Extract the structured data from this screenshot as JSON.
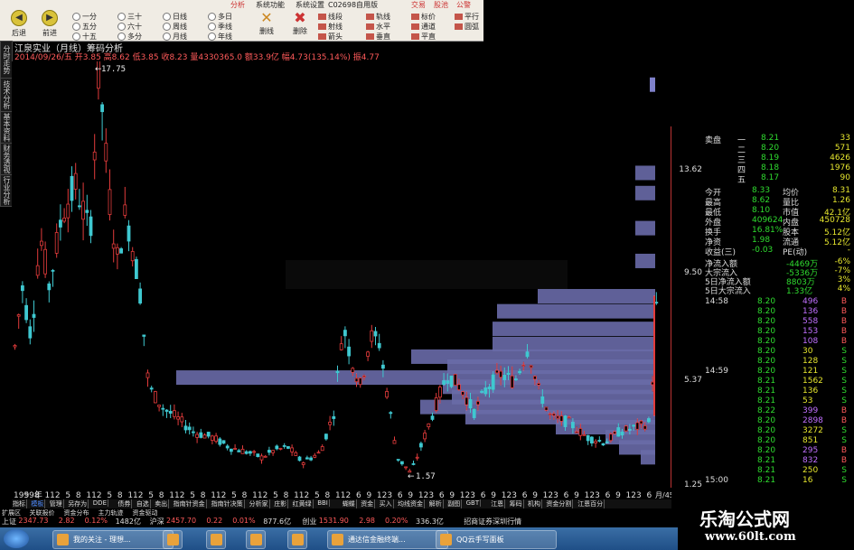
{
  "menu": {
    "items": [
      "分析",
      "系统功能",
      "系统设置",
      "C02698自用版",
      "交易",
      "股池",
      "公警"
    ]
  },
  "toolbar": {
    "back": "后退",
    "forward": "前进",
    "periods": [
      "一分",
      "五分",
      "十五",
      "三十",
      "六十",
      "多分",
      "日线",
      "周线",
      "月线",
      "多日",
      "季线",
      "年线"
    ],
    "delete_draw": "删线",
    "delete_all": "删除",
    "draw_tools": [
      "线段",
      "射线",
      "箭头",
      "轨线",
      "水平",
      "垂直",
      "标价",
      "通道",
      "平直",
      "平行",
      "圆弧"
    ]
  },
  "header": {
    "title": "江泉实业（月线）筹码分析",
    "quote": "2014/09/26/五 开3.85 高8.62 低3.85 收8.23 量4330365.0 额33.9亿 幅4.73(135.14%) 振4.77"
  },
  "left_tabs": [
    "分时走势",
    "技术分析",
    "基本资料",
    "财务透视",
    "行业分析"
  ],
  "chart_data": {
    "type": "candlestick",
    "price_axis_ticks": [
      "13.62",
      "9.50",
      "5.37",
      "1.25"
    ],
    "annotations": {
      "high": "17.75",
      "low": "1.57"
    },
    "x_tick_labels": [
      "1999年",
      "5",
      "8",
      "11",
      "2",
      "5",
      "8",
      "11",
      "2",
      "5",
      "8",
      "11",
      "2",
      "5",
      "8",
      "11",
      "2",
      "5",
      "8",
      "11",
      "2",
      "5",
      "8",
      "11",
      "2",
      "5",
      "8",
      "11",
      "2",
      "5",
      "8",
      "11",
      "2",
      "6",
      "9",
      "12",
      "3",
      "6",
      "9",
      "12",
      "3",
      "6",
      "9",
      "12",
      "3",
      "6",
      "9",
      "12",
      "3",
      "6",
      "9",
      "12",
      "3",
      "6",
      "9",
      "12",
      "3",
      "6",
      "9",
      "12",
      "3",
      "6"
    ],
    "x_axis_edge": "月/45",
    "colors": {
      "up": "#e23b3b",
      "down": "#3fc8d0",
      "chip_bar": "#8d8fe0"
    }
  },
  "quote_panel": {
    "sell": [
      {
        "label": "卖盘",
        "level": "一",
        "price": "8.21",
        "vol": "33"
      }
    ],
    "buy": [
      {
        "level": "二",
        "price": "8.20",
        "vol": "571"
      },
      {
        "level": "三",
        "price": "8.19",
        "vol": "4626"
      },
      {
        "level": "四",
        "price": "8.18",
        "vol": "1976"
      },
      {
        "level": "五",
        "price": "8.17",
        "vol": "90"
      }
    ],
    "stats": [
      {
        "k1": "今开",
        "v1": "8.33",
        "k2": "均价",
        "v2": "8.31"
      },
      {
        "k1": "最高",
        "v1": "8.62",
        "k2": "量比",
        "v2": "1.26"
      },
      {
        "k1": "最低",
        "v1": "8.10",
        "k2": "市值",
        "v2": "42.1亿"
      },
      {
        "k1": "外盘",
        "v1": "409624",
        "k2": "内盘",
        "v2": "450728"
      },
      {
        "k1": "换手",
        "v1": "16.81%",
        "k2": "股本",
        "v2": "5.12亿"
      },
      {
        "k1": "净资",
        "v1": "1.98",
        "k2": "流通",
        "v2": "5.12亿"
      },
      {
        "k1": "收益(三)",
        "v1": "-0.03",
        "k2": "PE(动)",
        "v2": "-"
      }
    ],
    "flows": [
      {
        "k": "净流入额",
        "v": "-4469万",
        "p": "-6%"
      },
      {
        "k": "大宗流入",
        "v": "-5336万",
        "p": "-7%"
      },
      {
        "k": "5日净流入额",
        "v": "8803万",
        "p": "3%"
      },
      {
        "k": "5日大宗流入",
        "v": "1.33亿",
        "p": "4%"
      }
    ],
    "ticks": [
      {
        "t": "14:58",
        "p": "8.20",
        "v": "496",
        "d": "B"
      },
      {
        "t": "",
        "p": "8.20",
        "v": "136",
        "d": "B"
      },
      {
        "t": "",
        "p": "8.20",
        "v": "558",
        "d": "B"
      },
      {
        "t": "",
        "p": "8.20",
        "v": "153",
        "d": "B"
      },
      {
        "t": "",
        "p": "8.20",
        "v": "108",
        "d": "B"
      },
      {
        "t": "",
        "p": "8.20",
        "v": "30",
        "d": "S"
      },
      {
        "t": "",
        "p": "8.20",
        "v": "128",
        "d": "S"
      },
      {
        "t": "14:59",
        "p": "8.20",
        "v": "121",
        "d": "S"
      },
      {
        "t": "",
        "p": "8.21",
        "v": "1562",
        "d": "S"
      },
      {
        "t": "",
        "p": "8.21",
        "v": "136",
        "d": "S"
      },
      {
        "t": "",
        "p": "8.21",
        "v": "53",
        "d": "S"
      },
      {
        "t": "",
        "p": "8.22",
        "v": "399",
        "d": "B"
      },
      {
        "t": "",
        "p": "8.20",
        "v": "2898",
        "d": "B"
      },
      {
        "t": "",
        "p": "8.20",
        "v": "3272",
        "d": "S"
      },
      {
        "t": "",
        "p": "8.20",
        "v": "851",
        "d": "S"
      },
      {
        "t": "",
        "p": "8.20",
        "v": "295",
        "d": "B"
      },
      {
        "t": "",
        "p": "8.21",
        "v": "832",
        "d": "B"
      },
      {
        "t": "",
        "p": "8.21",
        "v": "250",
        "d": "S"
      },
      {
        "t": "15:00",
        "p": "8.21",
        "v": "16",
        "d": "S"
      }
    ]
  },
  "indicator_tabs": [
    "指标",
    "模板",
    "管理",
    "另存为",
    "DDE",
    "债券",
    "自选",
    "卖出",
    "指南针资金",
    "指南针决策",
    "分析家",
    "庄影",
    "红黄绿",
    "BBI",
    "蝴蝶",
    "资金",
    "买入",
    "均线资金",
    "解析",
    "副图",
    "GBT",
    "江恩",
    "筹码",
    "机构",
    "资金分割",
    "江恩百分"
  ],
  "lower_tabs": [
    "扩展区",
    "关联报价",
    "资金分布",
    "主力轨迹",
    "资金驱动"
  ],
  "ticker": [
    {
      "name": "上证",
      "val": "2347.73",
      "chg": "2.82",
      "pct": "0.12%",
      "amt": "1482亿"
    },
    {
      "name": "沪深",
      "val": "2457.70",
      "chg": "0.22",
      "pct": "0.01%",
      "amt": "877.6亿"
    },
    {
      "name": "创业",
      "val": "1531.90",
      "chg": "2.98",
      "pct": "0.20%",
      "amt": "336.3亿"
    }
  ],
  "ticker_extra": "招商证券深圳行情",
  "taskbar": {
    "tasks": [
      "我的关注 - 理想...",
      "",
      "",
      "",
      "",
      "通达信金融终端...",
      "QQ云手写面板"
    ]
  },
  "watermark": {
    "line1": "乐淘公式网",
    "line2": "www.60lt.com"
  }
}
